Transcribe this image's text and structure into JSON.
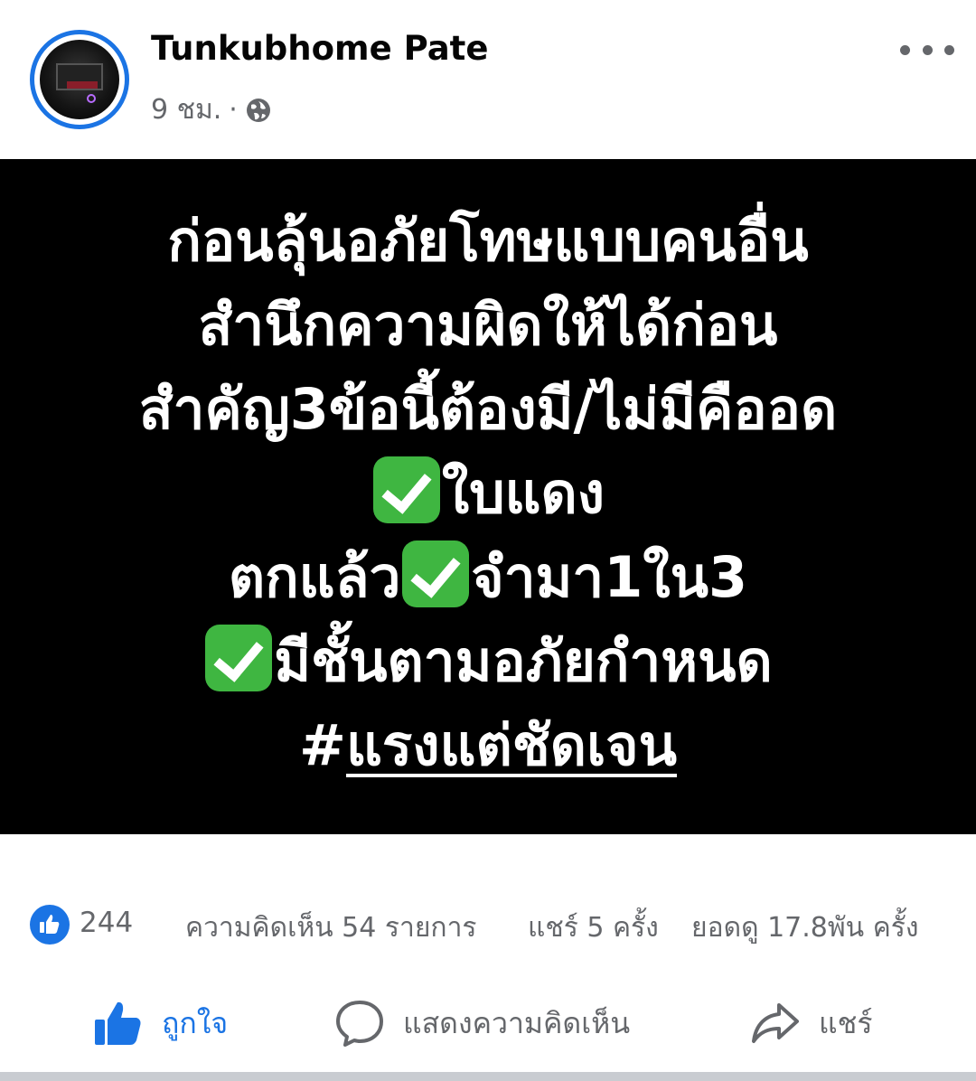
{
  "post": {
    "author": "Tunkubhome Pate",
    "time": "9 ชม.",
    "separator": "·",
    "privacy_icon": "globe-icon",
    "more_icon": "more-options-icon"
  },
  "image_text": {
    "line1": "ก่อนลุ้นอภัยโทษแบบคนอื่น",
    "line2": "สำนึกความผิดให้ได้ก่อน",
    "line3": "สำคัญ3ข้อนี้ต้องมี/ไม่มีคืออด",
    "line4": "ใบแดง",
    "line5a": "ตกแล้ว",
    "line5b": "จำมา1ใน3",
    "line6": "มีชั้นตามอภัยกำหนด",
    "hashtag_prefix": "#",
    "hashtag": "แรงแต่ชัดเจน"
  },
  "stats": {
    "likes": "244",
    "comments": "ความคิดเห็น 54 รายการ",
    "shares": "แชร์ 5 ครั้ง",
    "views": "ยอดดู 17.8พัน ครั้ง"
  },
  "actions": {
    "like": "ถูกใจ",
    "comment": "แสดงความคิดเห็น",
    "share": "แชร์"
  },
  "colors": {
    "accent": "#1b74e4",
    "muted": "#65676b",
    "check": "#3fb641"
  }
}
